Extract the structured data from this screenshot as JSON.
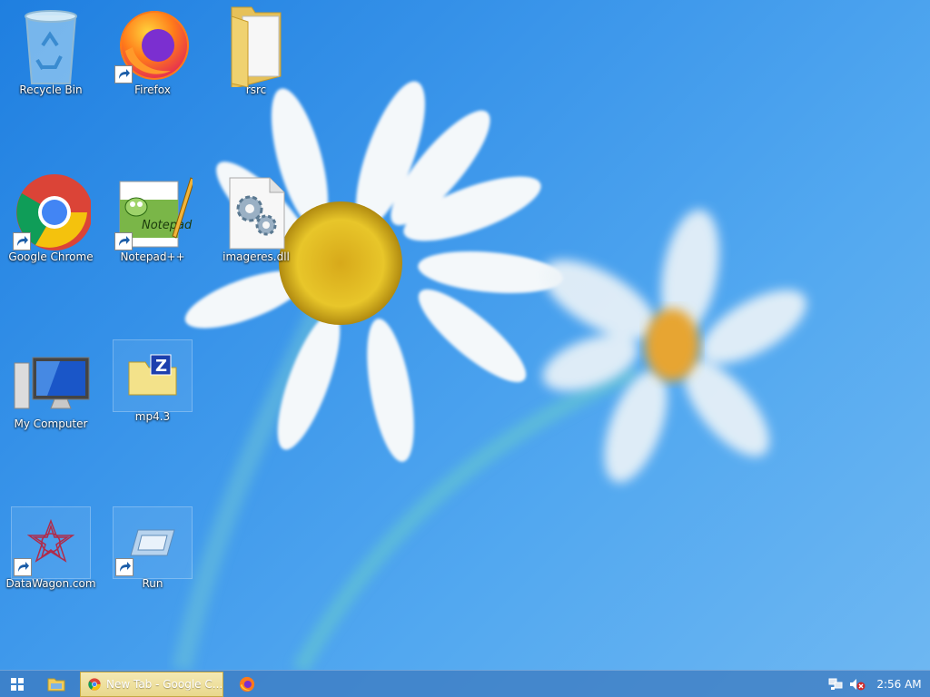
{
  "desktop": {
    "icons": [
      {
        "label": "Recycle Bin",
        "icon": "recycle-bin-icon"
      },
      {
        "label": "Firefox",
        "icon": "firefox-icon"
      },
      {
        "label": "rsrc",
        "icon": "folder-icon"
      },
      {
        "label": "Google Chrome",
        "icon": "chrome-icon"
      },
      {
        "label": "Notepad++",
        "icon": "notepad-plus-plus-icon"
      },
      {
        "label": "imageres.dll",
        "icon": "dll-file-icon"
      },
      {
        "label": "My Computer",
        "icon": "computer-icon"
      },
      {
        "label": "mp4.3",
        "icon": "zip-folder-icon"
      },
      {
        "label": "DataWagon.com",
        "icon": "datawagon-icon"
      },
      {
        "label": "Run",
        "icon": "run-icon"
      }
    ]
  },
  "taskbar": {
    "active_window_title": "New Tab - Google C...",
    "clock": "2:56 AM"
  },
  "colors": {
    "desktop_blue": "#3a95ea",
    "taskbar": "#3c78be",
    "active_task": "#ecdc96"
  }
}
